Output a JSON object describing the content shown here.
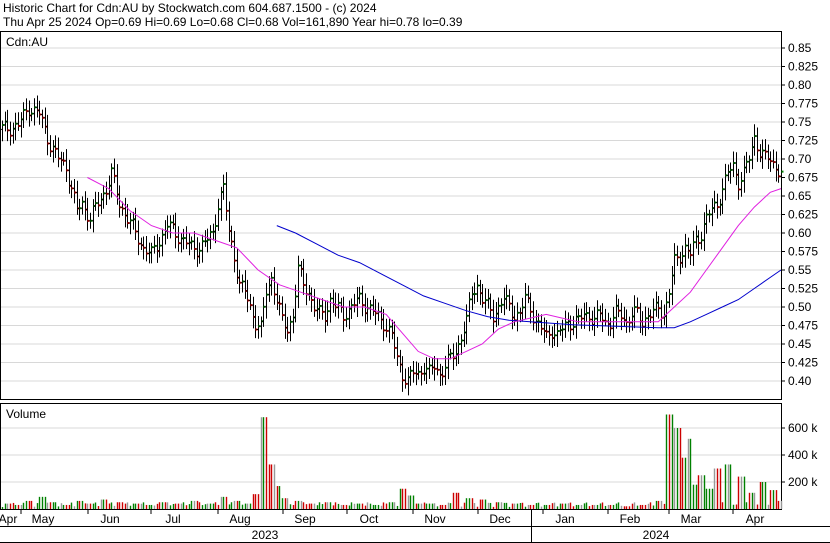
{
  "header": {
    "line1": "Historic Chart for Cdn:AU by Stockwatch.com 604.687.1500 - (c) 2024",
    "line2": "Thu Apr 25 2024  Op=0.69  Hi=0.69  Lo=0.68  Cl=0.68  Vol=161,890  Year hi=0.78  lo=0.39"
  },
  "chart_data": {
    "type": "ohlc_bar_with_volume",
    "symbol_label": "Cdn:AU",
    "volume_label": "Volume",
    "price_ticks": [
      "0.85",
      "0.825",
      "0.80",
      "0.775",
      "0.75",
      "0.725",
      "0.70",
      "0.675",
      "0.65",
      "0.625",
      "0.60",
      "0.575",
      "0.55",
      "0.525",
      "0.50",
      "0.475",
      "0.45",
      "0.425",
      "0.40"
    ],
    "price_range": [
      0.38,
      0.86
    ],
    "volume_ticks": [
      "600 k",
      "400 k",
      "200 k"
    ],
    "volume_range": [
      0,
      800000
    ],
    "month_labels": [
      "Apr",
      "May",
      "Jun",
      "Jul",
      "Aug",
      "Sep",
      "Oct",
      "Nov",
      "Dec",
      "Jan",
      "Feb",
      "Mar",
      "Apr"
    ],
    "year_labels": [
      "2023",
      "2024"
    ],
    "colors": {
      "up": "#008000",
      "down": "#cc0000",
      "ma_short": "#e020e0",
      "ma_long": "#0000cc",
      "bar": "#000000"
    },
    "price_path": [
      [
        0,
        0.74
      ],
      [
        6,
        0.745
      ],
      [
        10,
        0.77
      ],
      [
        14,
        0.76
      ],
      [
        18,
        0.72
      ],
      [
        21,
        0.7
      ],
      [
        24,
        0.69
      ],
      [
        26,
        0.66
      ],
      [
        28,
        0.63
      ],
      [
        30,
        0.64
      ],
      [
        33,
        0.62
      ],
      [
        36,
        0.64
      ],
      [
        39,
        0.66
      ],
      [
        41,
        0.68
      ],
      [
        44,
        0.64
      ],
      [
        47,
        0.62
      ],
      [
        50,
        0.6
      ],
      [
        53,
        0.58
      ],
      [
        56,
        0.57
      ],
      [
        59,
        0.59
      ],
      [
        62,
        0.61
      ],
      [
        65,
        0.6
      ],
      [
        68,
        0.59
      ],
      [
        71,
        0.58
      ],
      [
        74,
        0.58
      ],
      [
        77,
        0.59
      ],
      [
        79,
        0.6
      ],
      [
        81,
        0.64
      ],
      [
        83,
        0.66
      ],
      [
        85,
        0.6
      ],
      [
        87,
        0.57
      ],
      [
        89,
        0.53
      ],
      [
        91,
        0.52
      ],
      [
        93,
        0.5
      ],
      [
        95,
        0.48
      ],
      [
        97,
        0.47
      ],
      [
        99,
        0.52
      ],
      [
        101,
        0.54
      ],
      [
        103,
        0.51
      ],
      [
        105,
        0.48
      ],
      [
        107,
        0.47
      ],
      [
        109,
        0.49
      ],
      [
        111,
        0.55
      ],
      [
        113,
        0.53
      ],
      [
        115,
        0.52
      ],
      [
        117,
        0.5
      ],
      [
        119,
        0.49
      ],
      [
        121,
        0.49
      ],
      [
        123,
        0.51
      ],
      [
        125,
        0.5
      ],
      [
        128,
        0.49
      ],
      [
        131,
        0.5
      ],
      [
        134,
        0.51
      ],
      [
        137,
        0.5
      ],
      [
        140,
        0.49
      ],
      [
        143,
        0.48
      ],
      [
        146,
        0.46
      ],
      [
        148,
        0.43
      ],
      [
        150,
        0.41
      ],
      [
        152,
        0.4
      ],
      [
        154,
        0.41
      ],
      [
        156,
        0.41
      ],
      [
        158,
        0.42
      ],
      [
        160,
        0.41
      ],
      [
        162,
        0.42
      ],
      [
        164,
        0.41
      ],
      [
        166,
        0.42
      ],
      [
        168,
        0.43
      ],
      [
        170,
        0.44
      ],
      [
        172,
        0.46
      ],
      [
        174,
        0.48
      ],
      [
        176,
        0.52
      ],
      [
        178,
        0.53
      ],
      [
        180,
        0.51
      ],
      [
        182,
        0.5
      ],
      [
        184,
        0.49
      ],
      [
        186,
        0.5
      ],
      [
        188,
        0.51
      ],
      [
        190,
        0.5
      ],
      [
        192,
        0.49
      ],
      [
        194,
        0.49
      ],
      [
        196,
        0.51
      ],
      [
        198,
        0.5
      ],
      [
        200,
        0.48
      ],
      [
        202,
        0.47
      ],
      [
        204,
        0.46
      ],
      [
        206,
        0.47
      ],
      [
        208,
        0.46
      ],
      [
        210,
        0.47
      ],
      [
        212,
        0.48
      ],
      [
        214,
        0.48
      ],
      [
        216,
        0.48
      ],
      [
        218,
        0.49
      ],
      [
        220,
        0.49
      ],
      [
        222,
        0.48
      ],
      [
        224,
        0.49
      ],
      [
        226,
        0.48
      ],
      [
        228,
        0.48
      ],
      [
        230,
        0.49
      ],
      [
        232,
        0.49
      ],
      [
        234,
        0.48
      ],
      [
        236,
        0.49
      ],
      [
        238,
        0.49
      ],
      [
        240,
        0.48
      ],
      [
        242,
        0.49
      ],
      [
        244,
        0.49
      ],
      [
        246,
        0.5
      ],
      [
        248,
        0.49
      ],
      [
        250,
        0.52
      ],
      [
        252,
        0.56
      ],
      [
        254,
        0.57
      ],
      [
        256,
        0.58
      ],
      [
        258,
        0.57
      ],
      [
        260,
        0.59
      ],
      [
        262,
        0.6
      ],
      [
        264,
        0.62
      ],
      [
        266,
        0.63
      ],
      [
        268,
        0.64
      ],
      [
        270,
        0.66
      ],
      [
        272,
        0.68
      ],
      [
        274,
        0.69
      ],
      [
        276,
        0.67
      ],
      [
        278,
        0.68
      ],
      [
        280,
        0.7
      ],
      [
        282,
        0.73
      ],
      [
        284,
        0.71
      ],
      [
        286,
        0.7
      ],
      [
        288,
        0.7
      ],
      [
        290,
        0.69
      ],
      [
        292,
        0.68
      ]
    ],
    "ma_short": [
      [
        32,
        0.675
      ],
      [
        40,
        0.66
      ],
      [
        48,
        0.63
      ],
      [
        56,
        0.61
      ],
      [
        64,
        0.6
      ],
      [
        72,
        0.6
      ],
      [
        80,
        0.59
      ],
      [
        88,
        0.58
      ],
      [
        96,
        0.55
      ],
      [
        104,
        0.53
      ],
      [
        112,
        0.52
      ],
      [
        120,
        0.51
      ],
      [
        128,
        0.5
      ],
      [
        136,
        0.5
      ],
      [
        144,
        0.49
      ],
      [
        150,
        0.465
      ],
      [
        156,
        0.44
      ],
      [
        162,
        0.43
      ],
      [
        168,
        0.43
      ],
      [
        174,
        0.44
      ],
      [
        180,
        0.45
      ],
      [
        186,
        0.47
      ],
      [
        192,
        0.48
      ],
      [
        198,
        0.485
      ],
      [
        204,
        0.49
      ],
      [
        210,
        0.485
      ],
      [
        216,
        0.48
      ],
      [
        222,
        0.48
      ],
      [
        228,
        0.48
      ],
      [
        234,
        0.48
      ],
      [
        240,
        0.48
      ],
      [
        246,
        0.48
      ],
      [
        252,
        0.5
      ],
      [
        258,
        0.52
      ],
      [
        264,
        0.55
      ],
      [
        270,
        0.58
      ],
      [
        276,
        0.61
      ],
      [
        282,
        0.635
      ],
      [
        288,
        0.655
      ],
      [
        292,
        0.66
      ]
    ],
    "ma_long": [
      [
        103,
        0.61
      ],
      [
        110,
        0.6
      ],
      [
        118,
        0.585
      ],
      [
        126,
        0.57
      ],
      [
        134,
        0.56
      ],
      [
        142,
        0.545
      ],
      [
        150,
        0.53
      ],
      [
        158,
        0.515
      ],
      [
        166,
        0.505
      ],
      [
        174,
        0.495
      ],
      [
        182,
        0.487
      ],
      [
        190,
        0.482
      ],
      [
        198,
        0.48
      ],
      [
        206,
        0.478
      ],
      [
        214,
        0.476
      ],
      [
        222,
        0.475
      ],
      [
        230,
        0.474
      ],
      [
        238,
        0.473
      ],
      [
        246,
        0.472
      ],
      [
        252,
        0.472
      ],
      [
        258,
        0.48
      ],
      [
        264,
        0.49
      ],
      [
        270,
        0.5
      ],
      [
        276,
        0.51
      ],
      [
        282,
        0.525
      ],
      [
        288,
        0.54
      ],
      [
        292,
        0.55
      ]
    ],
    "volume": [
      [
        2,
        40000
      ],
      [
        6,
        30000
      ],
      [
        10,
        60000
      ],
      [
        15,
        90000
      ],
      [
        19,
        50000
      ],
      [
        24,
        30000
      ],
      [
        29,
        60000
      ],
      [
        33,
        40000
      ],
      [
        38,
        70000
      ],
      [
        44,
        50000
      ],
      [
        50,
        40000
      ],
      [
        55,
        30000
      ],
      [
        60,
        50000
      ],
      [
        66,
        40000
      ],
      [
        72,
        60000
      ],
      [
        78,
        40000
      ],
      [
        83,
        90000
      ],
      [
        88,
        60000
      ],
      [
        92,
        40000
      ],
      [
        95,
        110000
      ],
      [
        98,
        680000
      ],
      [
        101,
        330000
      ],
      [
        103,
        170000
      ],
      [
        106,
        80000
      ],
      [
        111,
        60000
      ],
      [
        116,
        40000
      ],
      [
        122,
        50000
      ],
      [
        128,
        30000
      ],
      [
        134,
        40000
      ],
      [
        140,
        30000
      ],
      [
        146,
        50000
      ],
      [
        150,
        150000
      ],
      [
        153,
        100000
      ],
      [
        156,
        40000
      ],
      [
        160,
        40000
      ],
      [
        165,
        30000
      ],
      [
        170,
        120000
      ],
      [
        175,
        80000
      ],
      [
        180,
        70000
      ],
      [
        186,
        50000
      ],
      [
        192,
        40000
      ],
      [
        198,
        30000
      ],
      [
        204,
        30000
      ],
      [
        210,
        40000
      ],
      [
        216,
        30000
      ],
      [
        222,
        30000
      ],
      [
        228,
        30000
      ],
      [
        234,
        20000
      ],
      [
        240,
        30000
      ],
      [
        246,
        60000
      ],
      [
        250,
        700000
      ],
      [
        253,
        600000
      ],
      [
        255,
        380000
      ],
      [
        257,
        520000
      ],
      [
        259,
        180000
      ],
      [
        262,
        250000
      ],
      [
        265,
        150000
      ],
      [
        268,
        300000
      ],
      [
        272,
        330000
      ],
      [
        277,
        240000
      ],
      [
        281,
        120000
      ],
      [
        285,
        200000
      ],
      [
        289,
        140000
      ],
      [
        292,
        60000
      ]
    ]
  }
}
